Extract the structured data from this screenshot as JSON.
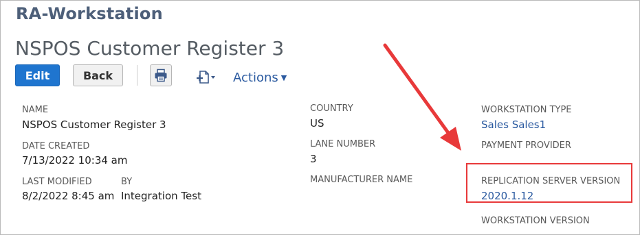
{
  "page": {
    "record_type": "RA-Workstation",
    "record_name": "NSPOS Customer Register 3"
  },
  "toolbar": {
    "edit_label": "Edit",
    "back_label": "Back",
    "print_icon": "printer-icon",
    "new_icon": "new-document-icon",
    "actions_label": "Actions"
  },
  "fields": {
    "name": {
      "label": "NAME",
      "value": "NSPOS Customer Register 3"
    },
    "date_created": {
      "label": "DATE CREATED",
      "value": "7/13/2022 10:34 am"
    },
    "last_modified": {
      "label": "LAST MODIFIED",
      "value": "8/2/2022 8:45 am"
    },
    "by": {
      "label": "BY",
      "value": "Integration Test"
    },
    "country": {
      "label": "COUNTRY",
      "value": "US"
    },
    "lane_number": {
      "label": "LANE NUMBER",
      "value": "3"
    },
    "manufacturer_name": {
      "label": "MANUFACTURER NAME",
      "value": ""
    },
    "workstation_type": {
      "label": "WORKSTATION TYPE",
      "value": "Sales Sales1"
    },
    "payment_provider": {
      "label": "PAYMENT PROVIDER",
      "value": ""
    },
    "replication_server_version": {
      "label": "REPLICATION SERVER VERSION",
      "value": "2020.1.12"
    },
    "workstation_version": {
      "label": "WORKSTATION VERSION",
      "value": ""
    }
  },
  "colors": {
    "accent_blue": "#1f75cf",
    "link_blue": "#2b5aa0",
    "annotation_red": "#e8393a",
    "title_slate": "#4d5f79"
  }
}
